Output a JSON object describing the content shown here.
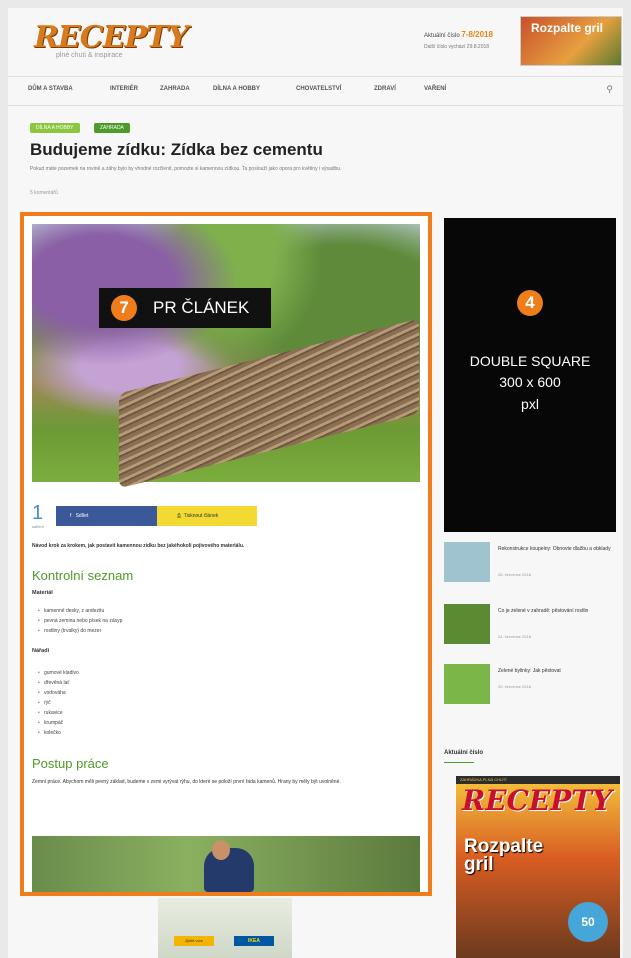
{
  "header": {
    "logo_text": "RECEPTY",
    "logo_sub": "plné chuti & inspirace",
    "issue_prefix": "Aktuální číslo",
    "issue_number": "7-8/2018",
    "issue_sub": "Další číslo vychází 29.8.2018",
    "cover_mini_text": "Rozpalte gril"
  },
  "nav": {
    "items": [
      "DŮM A STAVBA",
      "INTERIÉR",
      "ZAHRADA",
      "DÍLNA A HOBBY",
      "CHOVATELSTVÍ",
      "ZDRAVÍ",
      "VAŘENÍ"
    ],
    "search_icon": "search-icon"
  },
  "article": {
    "tags": [
      {
        "label": "DÍLNA A HOBBY",
        "color": "#8cc63f"
      },
      {
        "label": "ZAHRADA",
        "color": "#4e9a2a"
      }
    ],
    "title": "Budujeme zídku: Zídka bez cementu",
    "lead": "Pokud máte pozemek na rovině a záhy bylo by vhodné rozčlenit, pomozte si kamennou zídkou. Ta poslouží jako opora pro květiny i výsadbu.",
    "meta": "5 komentářů",
    "pr_label": {
      "number": "7",
      "text": "PR ČLÁNEK"
    },
    "share_count": "1",
    "share_count_label": "sdílení",
    "facebook_label": "Sdílet",
    "print_label": "Tisknout článek",
    "intro": "Návod krok za krokem, jak postavit kamennou zídku bez jakéhokoli pojivového materiálu.",
    "checklist_heading": "Kontrolní seznam",
    "materials_heading": "Materiál",
    "materials": [
      "kamenné desky, z andezitu",
      "pevná zemina nebo písek na zásyp",
      "rostliny (trvalky) do mezer"
    ],
    "tools_heading": "Nářadí",
    "tools": [
      "gumové kladivo",
      "dřevěná lať",
      "vodováha",
      "rýč",
      "rukavice",
      "krumpáč",
      "kolečko"
    ],
    "procedure_heading": "Postup práce",
    "procedure_text": "Zemní práce. Abychom měli pevný základ, budeme v zemi vyrývat rýhu, do které se položí první řada kamenů. Hrany by měly být uvolněné."
  },
  "ad_double_square": {
    "number": "4",
    "line1": "DOUBLE SQUARE",
    "line2": "300 x 600",
    "line3": "pxl"
  },
  "sidebar": {
    "items": [
      {
        "title": "Rekonstrukce koupelny: Obnovte dlažbu a obklady",
        "date": "28. července 2018",
        "thumb_color": "#9fc3cf"
      },
      {
        "title": "Co je zelené v zahradě: pěstování rostlin",
        "date": "24. července 2018",
        "thumb_color": "#5c8a32"
      },
      {
        "title": "Zelené bylinky: Jak pěstovat",
        "date": "20. července 2018",
        "thumb_color": "#7ab648"
      }
    ],
    "section_title": "Aktuální číslo",
    "cover": {
      "logo": "RECEPTY",
      "headline_line1": "Rozpalte",
      "headline_line2": "gril",
      "badge": "50",
      "topbar": "ZAHRÁDKA PLNÁ CHUTÍ"
    }
  },
  "bottom_ad": {
    "button1": "Zjistit více",
    "button2": "IKEA"
  }
}
